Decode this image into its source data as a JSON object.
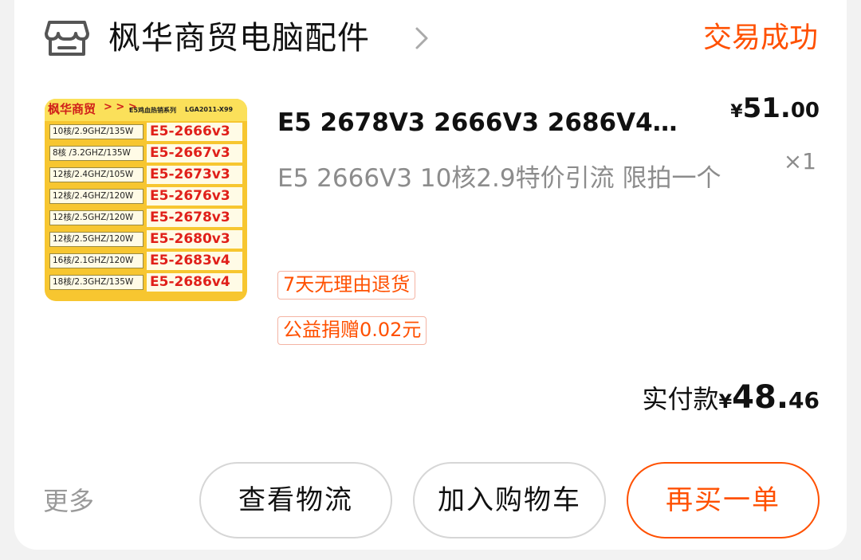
{
  "shop": {
    "name": "枫华商贸电脑配件",
    "icon": "store-icon",
    "chevron_icon": "chevron-right-icon",
    "status": "交易成功"
  },
  "product_image": {
    "brand": "枫华商贸",
    "arrows": "> > >",
    "series": "E5鸡血热销系列",
    "socket": "LGA2011-X99",
    "rows": [
      {
        "spec": "10核/2.9GHZ/135W",
        "model": "E5-2666v3"
      },
      {
        "spec": "8核 /3.2GHZ/135W",
        "model": "E5-2667v3"
      },
      {
        "spec": "12核/2.4GHZ/105W",
        "model": "E5-2673v3"
      },
      {
        "spec": "12核/2.4GHZ/120W",
        "model": "E5-2676v3"
      },
      {
        "spec": "12核/2.5GHZ/120W",
        "model": "E5-2678v3"
      },
      {
        "spec": "12核/2.5GHZ/120W",
        "model": "E5-2680v3"
      },
      {
        "spec": "16核/2.1GHZ/120W",
        "model": "E5-2683v4"
      },
      {
        "spec": "18核/2.3GHZ/135W",
        "model": "E5-2686v4"
      }
    ]
  },
  "product": {
    "title": "E5 2678V3 2666V3 2686V4…",
    "sku": "E5 2666V3 10核2.9特价引流 限拍一个",
    "price_symbol": "¥",
    "price_int": "51.",
    "price_dec": "00",
    "quantity": "×1",
    "tags": [
      "7天无理由退货",
      "公益捐赠0.02元"
    ]
  },
  "payment": {
    "label": "实付款",
    "symbol": "¥",
    "amount_int": "48.",
    "amount_dec": "46"
  },
  "footer": {
    "more_label": "更多",
    "buttons": {
      "logistics": "查看物流",
      "add_to_cart": "加入购物车",
      "rebuy": "再买一单"
    }
  },
  "colors": {
    "accent": "#ff5000",
    "muted": "#8c8c8c",
    "tag_border": "#f4b4a4"
  }
}
